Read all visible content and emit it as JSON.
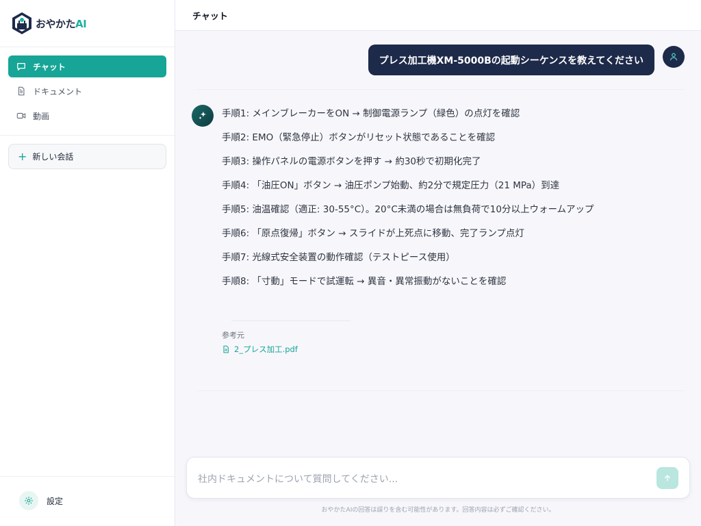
{
  "app": {
    "logo_text": "おやかた",
    "logo_accent": "AI"
  },
  "sidebar": {
    "items": [
      {
        "label": "チャット",
        "icon": "chat-icon",
        "active": true
      },
      {
        "label": "ドキュメント",
        "icon": "document-icon",
        "active": false
      },
      {
        "label": "動画",
        "icon": "video-icon",
        "active": false
      }
    ],
    "new_chat_label": "新しい会話",
    "settings_label": "設定"
  },
  "header": {
    "title": "チャット"
  },
  "chat": {
    "user_message": "プレス加工機XM-5000Bの起動シーケンスを教えてください",
    "assistant_steps": [
      "手順1: メインブレーカーをON → 制御電源ランプ（緑色）の点灯を確認",
      "手順2: EMO（緊急停止）ボタンがリセット状態であることを確認",
      "手順3: 操作パネルの電源ボタンを押す → 約30秒で初期化完了",
      "手順4: 「油圧ON」ボタン → 油圧ポンプ始動、約2分で規定圧力（21 MPa）到達",
      "手順5: 油温確認（適正: 30-55°C）。20°C未満の場合は無負荷で10分以上ウォームアップ",
      "手順6: 「原点復帰」ボタン → スライドが上死点に移動、完了ランプ点灯",
      "手順7: 光線式安全装置の動作確認（テストピース使用）",
      "手順8: 「寸動」モードで試運転 → 異音・異常振動がないことを確認"
    ],
    "reference_label": "参考元",
    "reference_file": "2_プレス加工.pdf"
  },
  "composer": {
    "placeholder": "社内ドキュメントについて質問してください...",
    "value": ""
  },
  "disclaimer": "おやかたAIの回答は誤りを含む可能性があります。回答内容は必ずご確認ください。",
  "colors": {
    "accent": "#16a596",
    "navy": "#1e2a4a",
    "send_button": "#b9e6df"
  }
}
